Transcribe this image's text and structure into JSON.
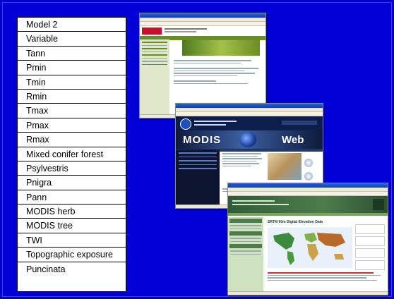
{
  "variables": [
    "Model 2",
    "Variable",
    "Tann",
    "Pmin",
    "Tmin",
    "Rmin",
    "Tmax",
    "Pmax",
    "Rmax",
    "Mixed conifer forest",
    "Psylvestris",
    "Pnigra",
    "Pann",
    "MODIS herb",
    "MODIS tree",
    "TWI",
    "Topographic exposure",
    "Puncinata"
  ],
  "screenshots": {
    "s1": {
      "logo_text": ""
    },
    "s2": {
      "banner_left": "MODIS",
      "banner_right": "Web"
    },
    "s3": {
      "heading": "SRTM 90m Digital Elevation Data"
    }
  },
  "colors": {
    "background": "#0000cc",
    "table_background": "#ffffff",
    "window_titlebar": "#1c4fc4",
    "modis_header": "#0b1f4a",
    "srtm_header": "#2f5d3a"
  }
}
